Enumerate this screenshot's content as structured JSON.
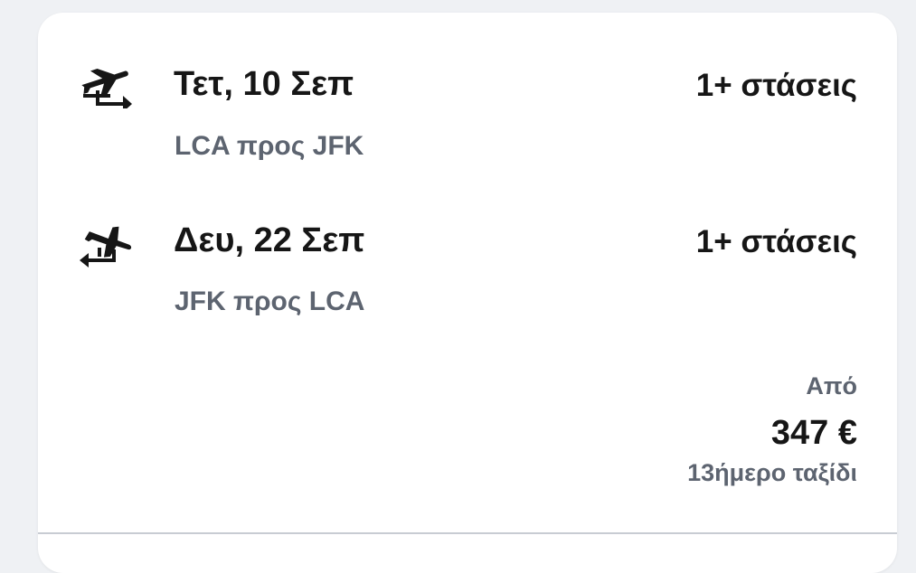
{
  "legs": [
    {
      "icon": "takeoff-icon",
      "date": "Τετ, 10 Σεπ",
      "stops": "1+ στάσεις",
      "route": "LCA προς JFK"
    },
    {
      "icon": "landing-icon",
      "date": "Δευ, 22 Σεπ",
      "stops": "1+ στάσεις",
      "route": "JFK προς LCA"
    }
  ],
  "price": {
    "from_label": "Από",
    "amount": "347 €",
    "trip_length": "13ήμερο ταξίδι"
  },
  "colors": {
    "background": "#eff1f4",
    "card": "#ffffff",
    "primary_text": "#161616",
    "secondary_text": "#5d6470"
  }
}
